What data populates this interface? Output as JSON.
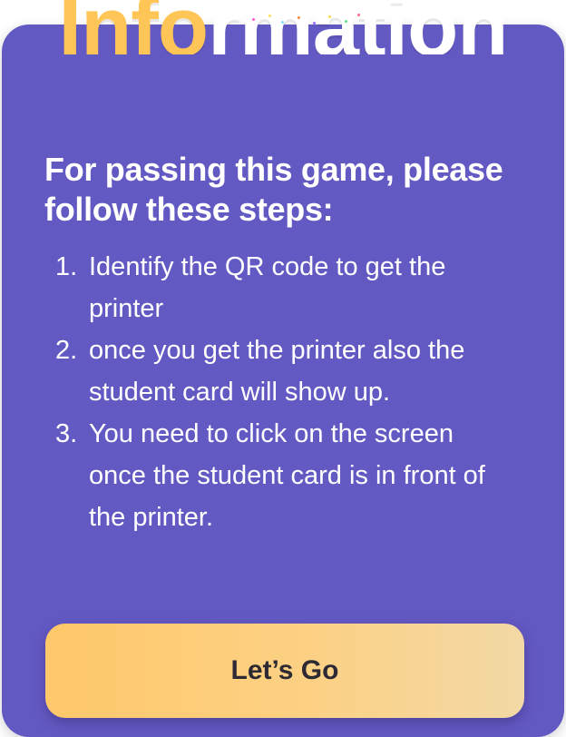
{
  "title": {
    "accent_part": "Info",
    "rest_part": "rmation"
  },
  "heading": "For passing this game, please follow these steps:",
  "steps": [
    {
      "number": "1.",
      "text": "Identify the QR code to get the printer"
    },
    {
      "number": "2.",
      "text": "once you get the printer also the student card will show up."
    },
    {
      "number": "3.",
      "text": "You need to click on the screen once the student card is in front of the printer."
    }
  ],
  "cta_label": "Let’s Go",
  "colors": {
    "card": "#6359c3",
    "accent": "#ffc657",
    "button_start": "#ffc86a",
    "button_end": "#f3d9a6"
  }
}
